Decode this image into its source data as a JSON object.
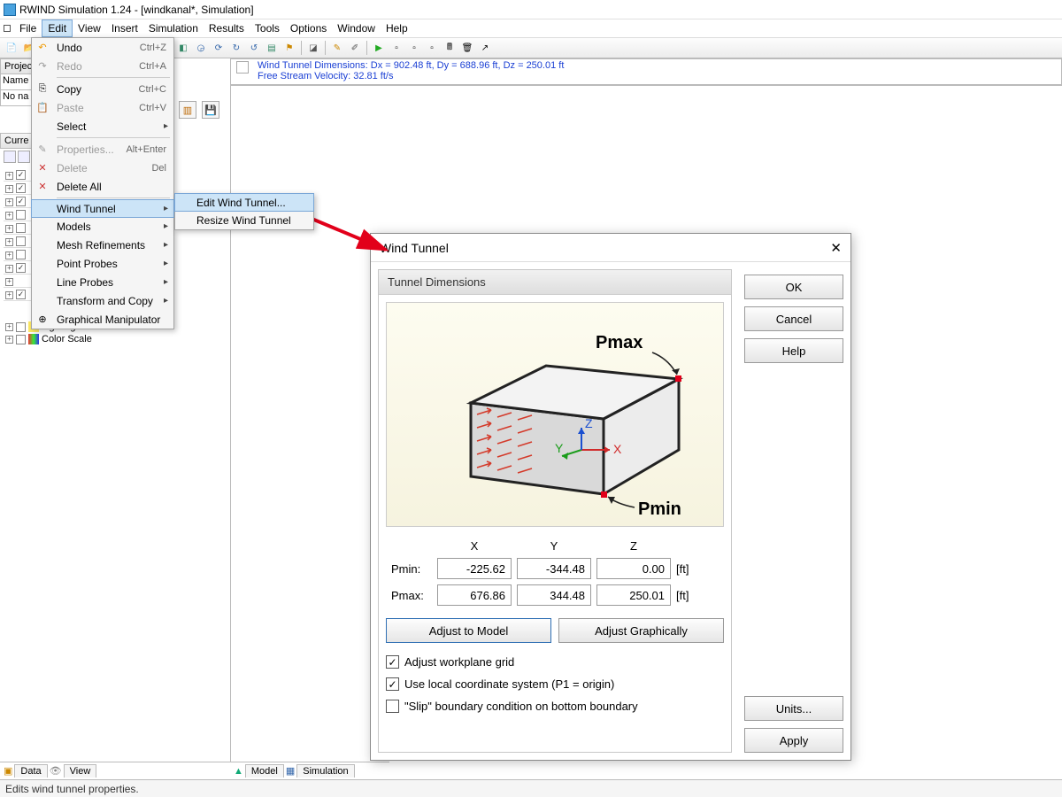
{
  "title": "RWIND Simulation 1.24 - [windkanal*, Simulation]",
  "menubar": [
    "File",
    "Edit",
    "View",
    "Insert",
    "Simulation",
    "Results",
    "Tools",
    "Options",
    "Window",
    "Help"
  ],
  "info": {
    "line1": "Wind Tunnel Dimensions: Dx = 902.48 ft, Dy = 688.96 ft, Dz = 250.01 ft",
    "line2": "Free Stream Velocity: 32.81 ft/s"
  },
  "left": {
    "project_lbl": "Project",
    "name_lbl": "Name",
    "noname": "No na",
    "current_lbl": "Curre",
    "tree": [
      {
        "label": "Lighting",
        "chk": true
      },
      {
        "label": "Color Scale",
        "chk": false
      }
    ]
  },
  "edit_menu": [
    {
      "label": "Undo",
      "shortcut": "Ctrl+Z",
      "icon": "↶"
    },
    {
      "label": "Redo",
      "shortcut": "Ctrl+A",
      "icon": "↷",
      "disabled": true
    },
    {
      "sep": true
    },
    {
      "label": "Copy",
      "shortcut": "Ctrl+C",
      "icon": "⎘"
    },
    {
      "label": "Paste",
      "shortcut": "Ctrl+V",
      "icon": "📋",
      "disabled": true
    },
    {
      "label": "Select",
      "sub": true
    },
    {
      "sep": true
    },
    {
      "label": "Properties...",
      "shortcut": "Alt+Enter",
      "disabled": true
    },
    {
      "label": "Delete",
      "shortcut": "Del",
      "disabled": true,
      "icon": "✕"
    },
    {
      "label": "Delete All",
      "icon": "✕"
    },
    {
      "sep": true
    },
    {
      "label": "Wind Tunnel",
      "sub": true,
      "hl": true
    },
    {
      "label": "Models",
      "sub": true
    },
    {
      "label": "Mesh Refinements",
      "sub": true
    },
    {
      "label": "Point Probes",
      "sub": true
    },
    {
      "label": "Line Probes",
      "sub": true
    },
    {
      "label": "Transform and Copy",
      "sub": true
    },
    {
      "label": "Graphical Manipulator",
      "icon": "⊕"
    }
  ],
  "submenu": [
    {
      "label": "Edit Wind Tunnel...",
      "hl": true
    },
    {
      "label": "Resize Wind Tunnel"
    }
  ],
  "dialog": {
    "title": "Wind Tunnel",
    "group": "Tunnel Dimensions",
    "illus": {
      "pmax": "Pmax",
      "pmin": "Pmin",
      "x": "X",
      "y": "Y",
      "z": "Z"
    },
    "cols": [
      "X",
      "Y",
      "Z"
    ],
    "rows": {
      "pmin_lbl": "Pmin:",
      "pmax_lbl": "Pmax:",
      "pmin": [
        "-225.62",
        "-344.48",
        "0.00"
      ],
      "pmax": [
        "676.86",
        "344.48",
        "250.01"
      ],
      "unit": "[ft]"
    },
    "adjust_model": "Adjust to Model",
    "adjust_graph": "Adjust Graphically",
    "checks": {
      "workplane": "Adjust workplane grid",
      "local": "Use local coordinate system (P1 = origin)",
      "slip": "\"Slip\" boundary condition on bottom boundary"
    },
    "side": {
      "ok": "OK",
      "cancel": "Cancel",
      "help": "Help",
      "units": "Units...",
      "apply": "Apply"
    }
  },
  "bottom": {
    "left": [
      "Data",
      "View"
    ],
    "mid": [
      "Model",
      "Simulation"
    ]
  },
  "status": "Edits wind tunnel properties."
}
